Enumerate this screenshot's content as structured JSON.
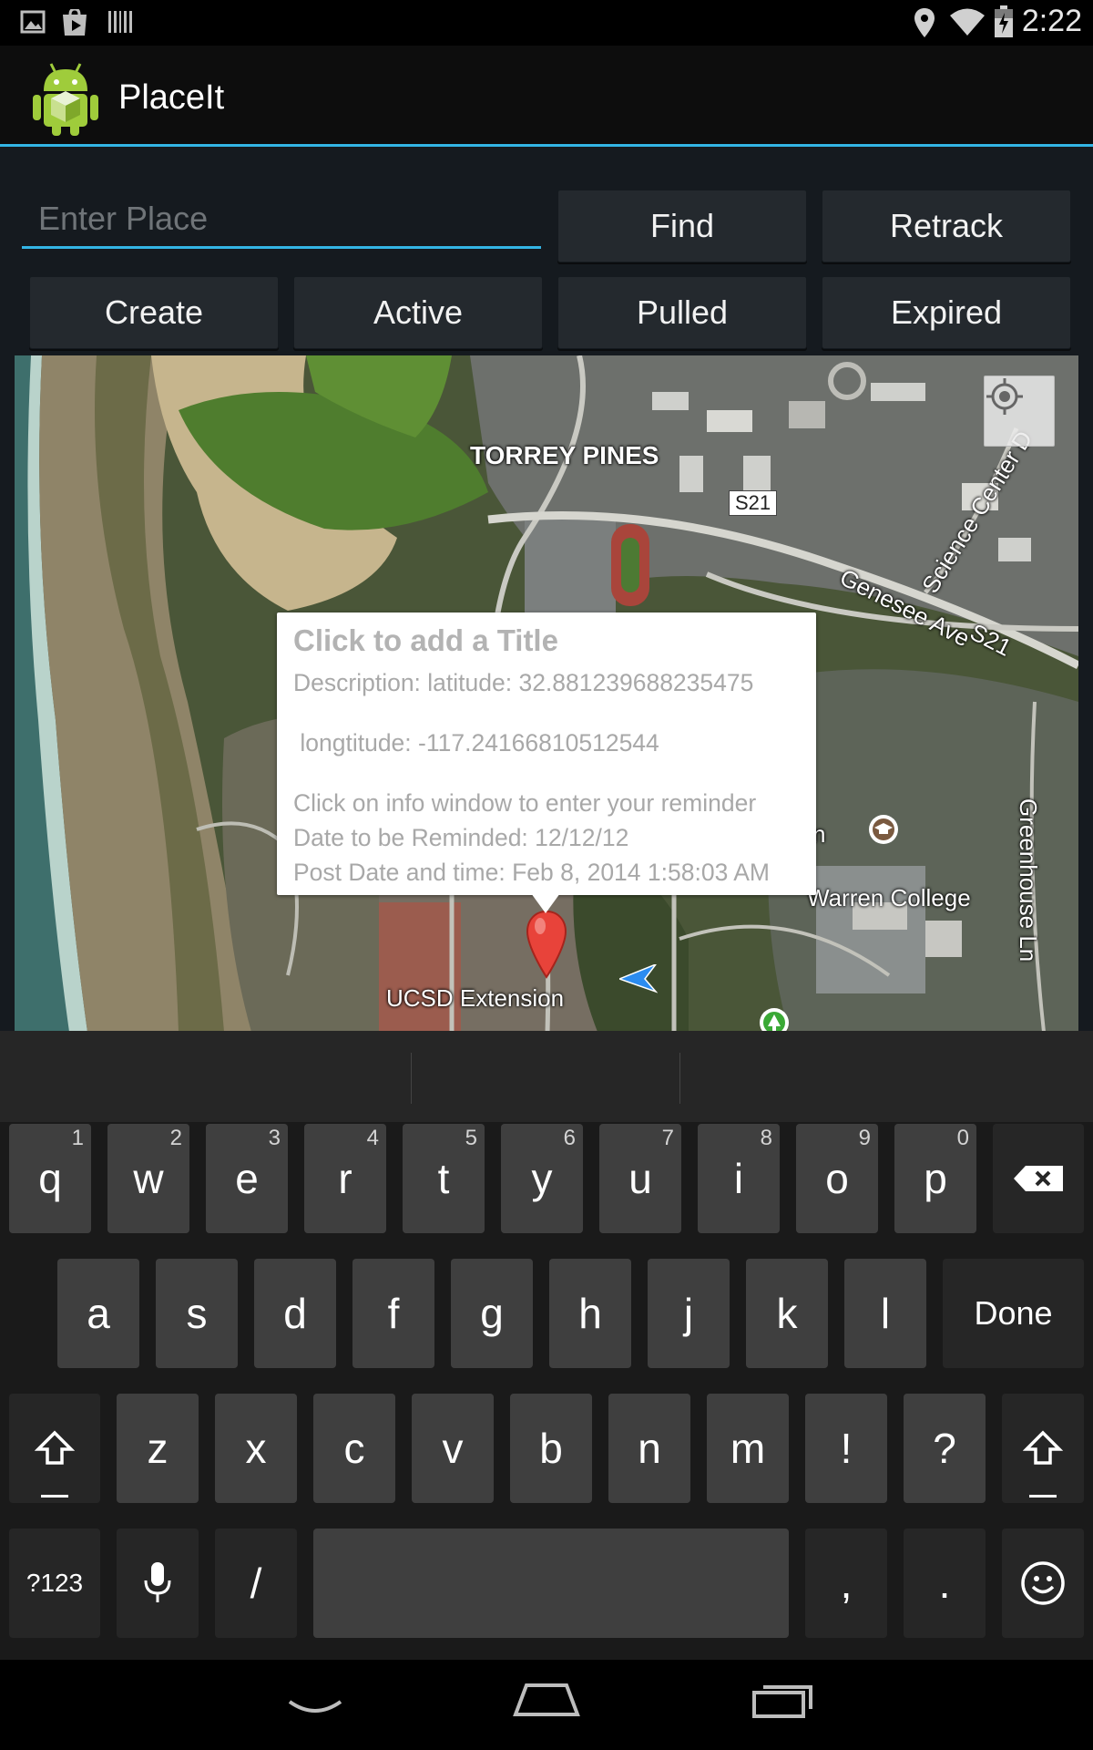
{
  "status_bar": {
    "time": "2:22",
    "left_icons": [
      "image-icon",
      "play-store-icon",
      "barcode-icon"
    ],
    "right_icons": [
      "location-icon",
      "wifi-icon",
      "battery-icon"
    ]
  },
  "action_bar": {
    "title": "PlaceIt",
    "logo": "android-logo-icon",
    "accent_color": "#33b5e5"
  },
  "search": {
    "placeholder": "Enter Place",
    "value": ""
  },
  "buttons": {
    "find": "Find",
    "retrack": "Retrack",
    "create": "Create",
    "active": "Active",
    "pulled": "Pulled",
    "expired": "Expired"
  },
  "map": {
    "labels": {
      "torrey_pines": "TORREY PINES",
      "s21": "S21",
      "genesee": "Genesee Ave",
      "genesee_s21": "S21",
      "science_center": "Science Center D",
      "greenhouse": "Greenhouse Ln",
      "warren": "Warren College",
      "ucsd_extension": "UCSD Extension",
      "partial_n": "n"
    },
    "info_window": {
      "title": "Click to add a Title",
      "description": "Description: latitude: 32.881239688235475",
      "longitude": " longtitude: -117.24166810512544",
      "hint": "Click on info window to enter your reminder",
      "remind_date": "Date to be Reminded: 12/12/12",
      "post_date": "Post Date and time: Feb 8, 2014 1:58:03 AM"
    }
  },
  "keyboard": {
    "row1": [
      {
        "k": "q",
        "h": "1"
      },
      {
        "k": "w",
        "h": "2"
      },
      {
        "k": "e",
        "h": "3"
      },
      {
        "k": "r",
        "h": "4"
      },
      {
        "k": "t",
        "h": "5"
      },
      {
        "k": "y",
        "h": "6"
      },
      {
        "k": "u",
        "h": "7"
      },
      {
        "k": "i",
        "h": "8"
      },
      {
        "k": "o",
        "h": "9"
      },
      {
        "k": "p",
        "h": "0"
      }
    ],
    "row2": [
      "a",
      "s",
      "d",
      "f",
      "g",
      "h",
      "j",
      "k",
      "l"
    ],
    "done": "Done",
    "row3": [
      "z",
      "x",
      "c",
      "v",
      "b",
      "n",
      "m",
      "!",
      "?"
    ],
    "symbols": "?123",
    "slash": "/",
    "comma": ",",
    "period": "."
  },
  "nav_bar": {
    "icons": [
      "back-icon",
      "home-icon",
      "recents-icon"
    ]
  }
}
